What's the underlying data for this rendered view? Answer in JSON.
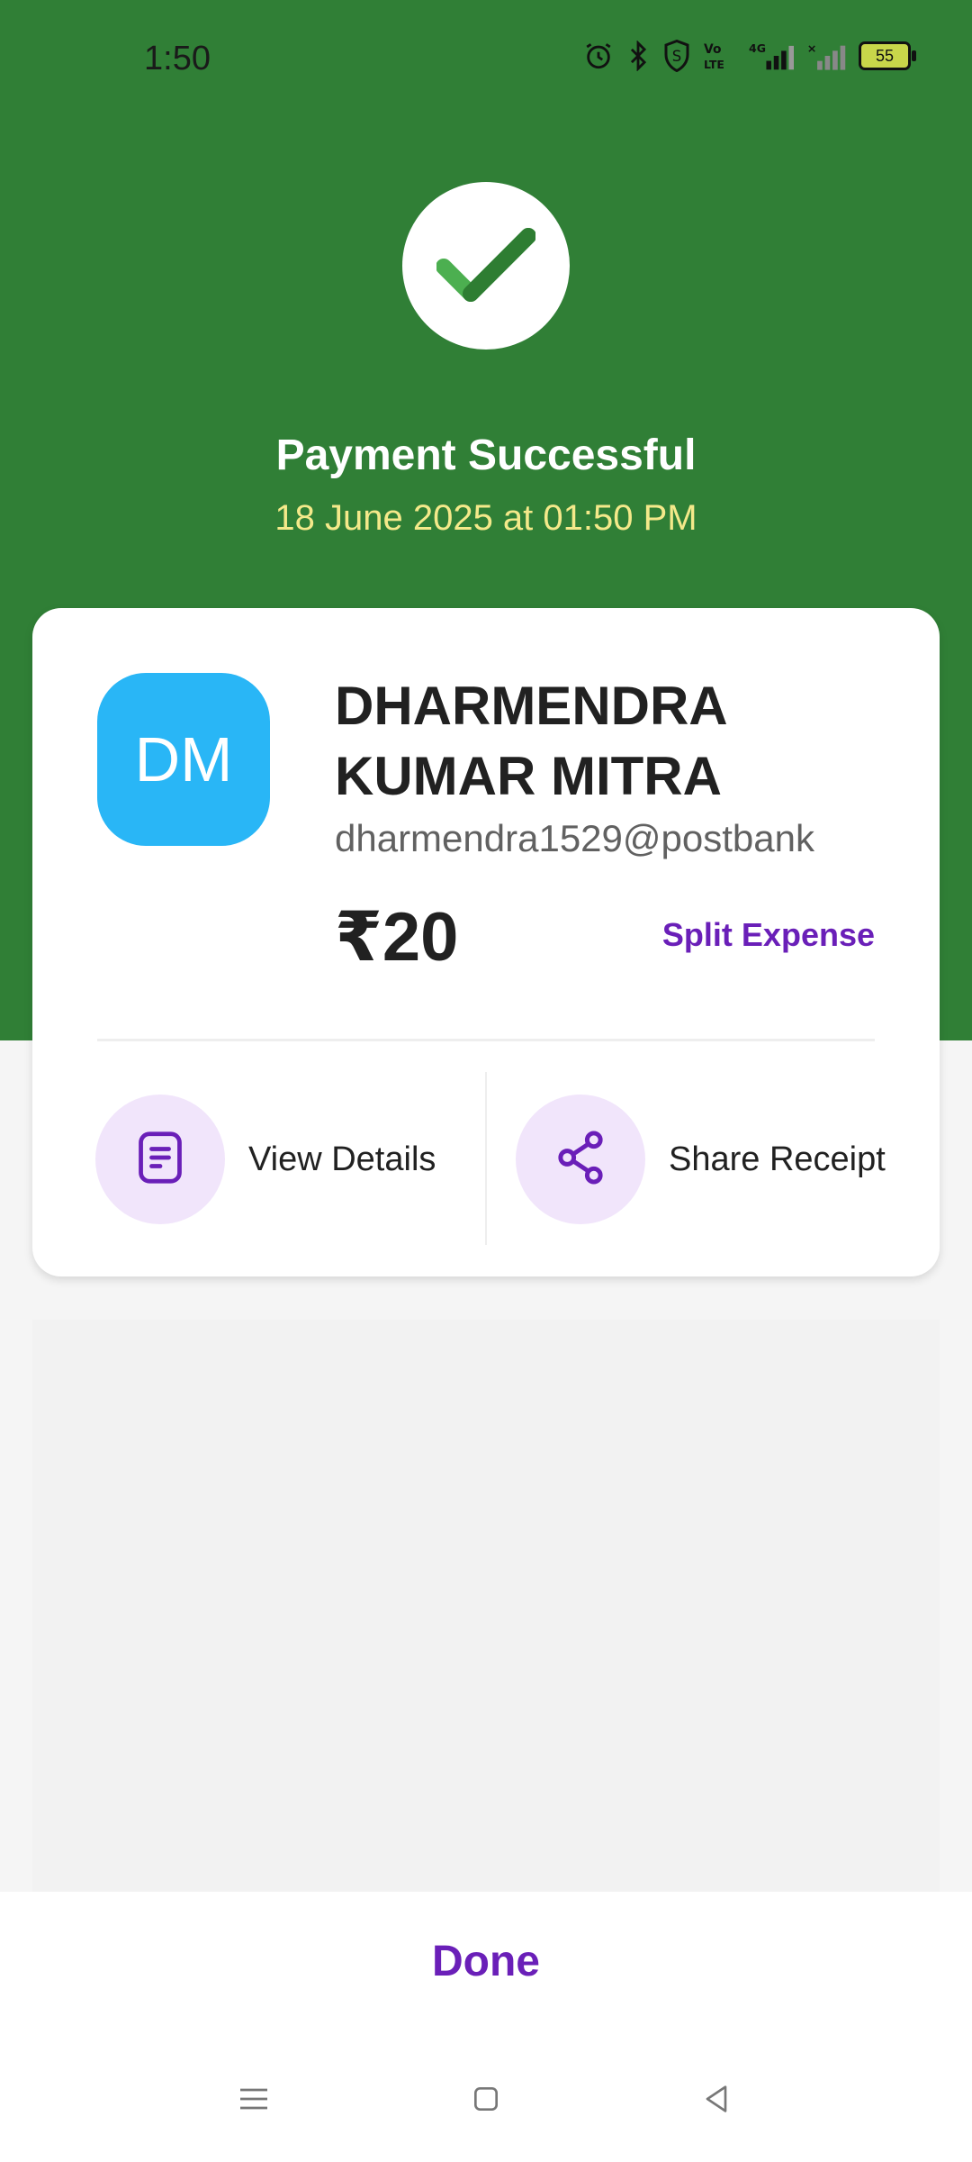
{
  "status_bar": {
    "time": "1:50",
    "battery": "55",
    "icons": [
      "alarm-icon",
      "bluetooth-icon",
      "shield-icon",
      "volte-icon",
      "signal-4g-icon",
      "signal-no-sim-icon",
      "battery-icon"
    ]
  },
  "header": {
    "status_icon": "check-icon",
    "title": "Payment Successful",
    "timestamp": "18 June 2025 at 01:50 PM",
    "background_color": "#307f36",
    "timestamp_color": "#f4e98a"
  },
  "payee": {
    "initials": "DM",
    "avatar_color": "#29b6f6",
    "name": "DHARMENDRA KUMAR MITRA",
    "upi_id": "dharmendra1529@postbank",
    "amount": "₹20",
    "split_label": "Split Expense"
  },
  "actions": {
    "view_details": {
      "label": "View Details",
      "icon": "document-icon"
    },
    "share_receipt": {
      "label": "Share Receipt",
      "icon": "share-icon"
    }
  },
  "footer": {
    "done_label": "Done",
    "accent_color": "#6a1fb8"
  },
  "nav": {
    "items": [
      "menu-icon",
      "home-icon",
      "back-icon"
    ]
  }
}
